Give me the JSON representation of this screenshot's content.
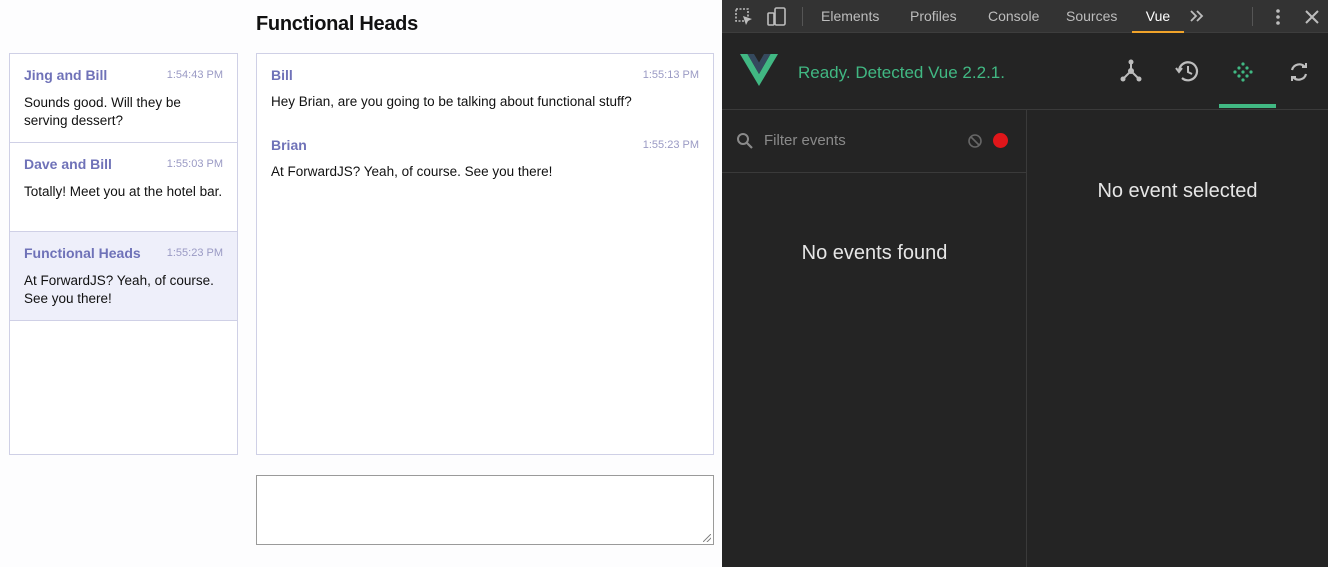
{
  "chat": {
    "title": "Functional Heads",
    "threads": [
      {
        "name": "Jing and Bill",
        "time": "1:54:43 PM",
        "preview": "Sounds good. Will they be serving dessert?",
        "active": false
      },
      {
        "name": "Dave and Bill",
        "time": "1:55:03 PM",
        "preview": "Totally! Meet you at the hotel bar.",
        "active": false
      },
      {
        "name": "Functional Heads",
        "time": "1:55:23 PM",
        "preview": "At ForwardJS? Yeah, of course. See you there!",
        "active": true
      }
    ],
    "messages": [
      {
        "name": "Bill",
        "time": "1:55:13 PM",
        "body": "Hey Brian, are you going to be talking about functional stuff?"
      },
      {
        "name": "Brian",
        "time": "1:55:23 PM",
        "body": "At ForwardJS? Yeah, of course. See you there!"
      }
    ],
    "composer_value": ""
  },
  "devtools": {
    "tabs": [
      "Elements",
      "Profiles",
      "Console",
      "Sources",
      "Vue"
    ],
    "active_tab": "Vue",
    "more_icon": "double-chevron-right-icon",
    "vue": {
      "status": "Ready. Detected Vue 2.2.1.",
      "accent_color": "#41b883",
      "filter_placeholder": "Filter events",
      "no_events": "No events found",
      "no_selection": "No event selected"
    }
  }
}
